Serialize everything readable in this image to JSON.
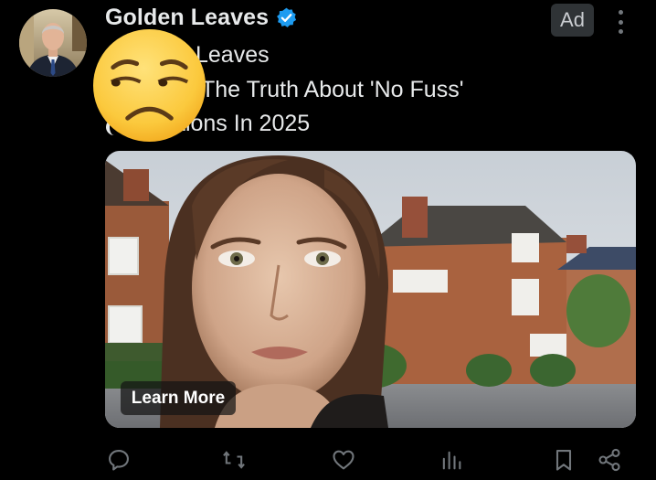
{
  "post": {
    "author_name": "Golden Leaves",
    "ad_label": "Ad",
    "text_lines": [
      "Leaves",
      "The Truth About 'No Fuss'",
      "tions In 2025"
    ],
    "cta_label": "Learn More"
  },
  "icons": {
    "verified": "verified-badge-icon",
    "more": "more-vertical-icon",
    "sticker": "unamused-face-emoji",
    "reply": "reply-icon",
    "repost": "repost-icon",
    "like": "heart-icon",
    "views": "views-chart-icon",
    "bookmark": "bookmark-icon",
    "share": "share-icon"
  },
  "colors": {
    "background": "#000000",
    "text": "#e7e9ea",
    "muted": "#71767b",
    "verified": "#1d9bf0",
    "ad_badge_bg": "#2f3336"
  }
}
